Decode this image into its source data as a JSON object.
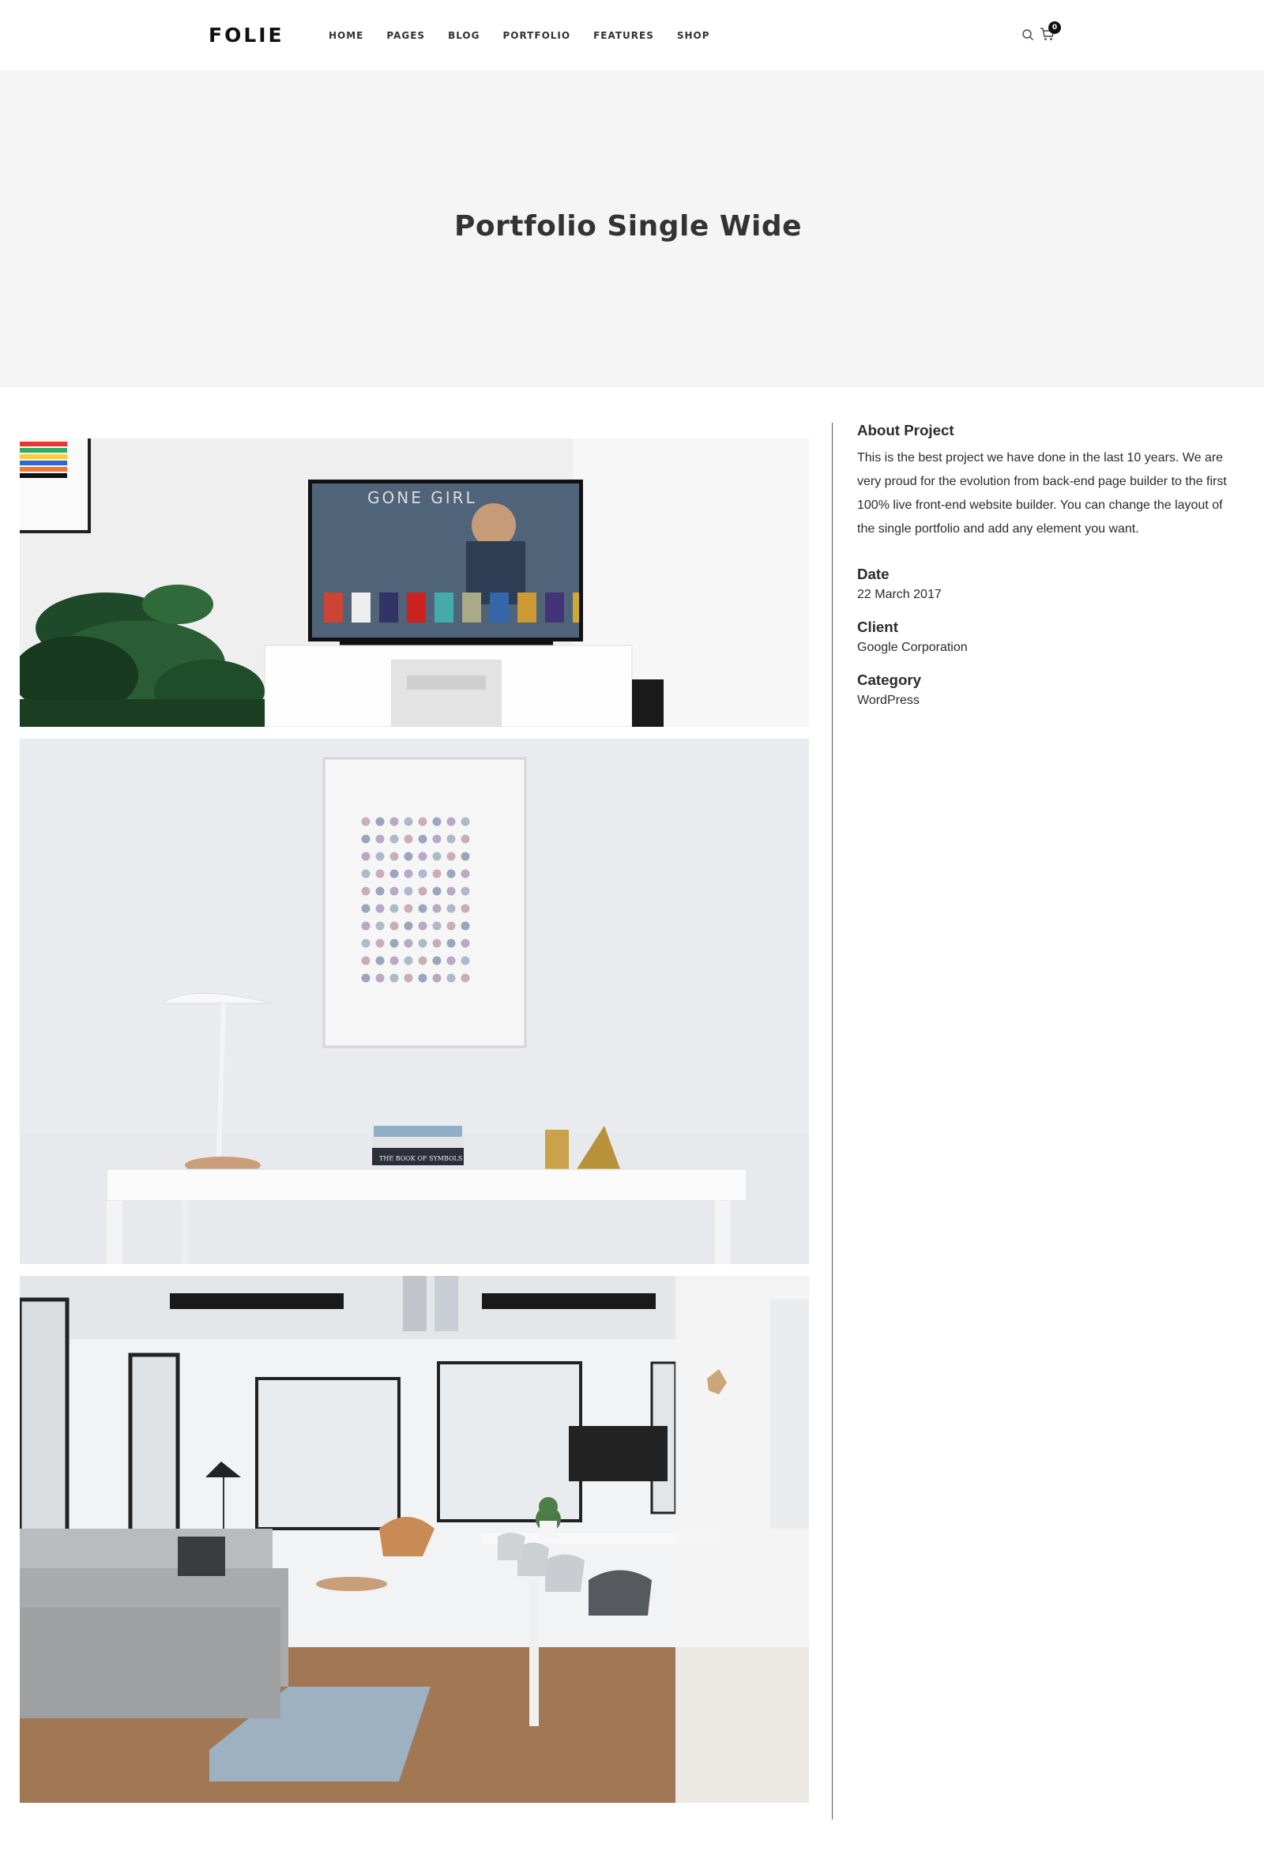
{
  "header": {
    "logo": "FOLIE",
    "nav": [
      "HOME",
      "PAGES",
      "BLOG",
      "PORTFOLIO",
      "FEATURES",
      "SHOP"
    ],
    "cart_count": "0",
    "icons": [
      "search-icon",
      "cart-icon"
    ]
  },
  "hero": {
    "title": "Portfolio Single Wide"
  },
  "gallery": {
    "tv_title": "GONE GIRL",
    "book_title": "THE BOOK OF SYMBOLS"
  },
  "sidebar": {
    "about_title": "About Project",
    "about_text": "This is the best  project we have done in the last 10 years. We are very proud for the evolution from back-end page builder to the first 100% live front-end website builder. You can change the layout of the single portfolio and add any element you want.",
    "date_title": "Date",
    "date_value": "22 March 2017",
    "client_title": "Client",
    "client_value": "Google Corporation",
    "category_title": "Category",
    "category_value": "WordPress"
  },
  "colors": {
    "hero_bg": "#f5f5f5",
    "text_dark": "#333333",
    "text_muted": "#777777"
  }
}
